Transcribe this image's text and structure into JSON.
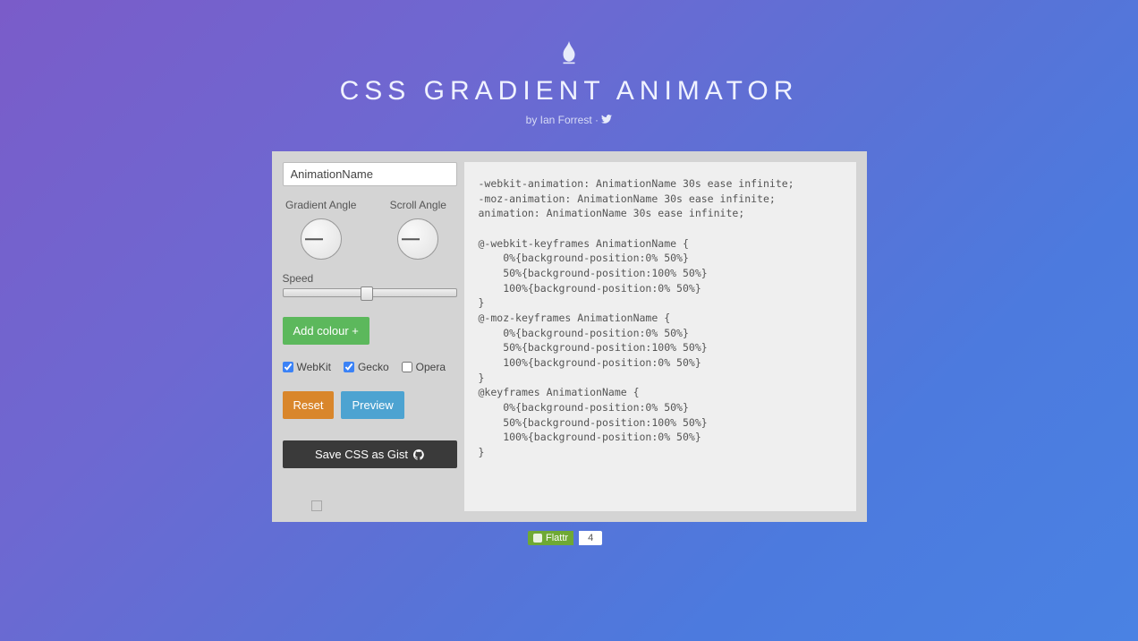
{
  "header": {
    "title": "CSS GRADIENT ANIMATOR",
    "byline_prefix": "by ",
    "author": "Ian Forrest",
    "separator": " · "
  },
  "controls": {
    "animation_name": "AnimationName",
    "gradient_angle_label": "Gradient Angle",
    "scroll_angle_label": "Scroll Angle",
    "speed_label": "Speed",
    "add_colour_label": "Add colour +",
    "vendors": {
      "webkit": {
        "label": "WebKit",
        "checked": true
      },
      "gecko": {
        "label": "Gecko",
        "checked": true
      },
      "opera": {
        "label": "Opera",
        "checked": false
      }
    },
    "reset_label": "Reset",
    "preview_label": "Preview",
    "gist_label": "Save CSS as Gist"
  },
  "code": "-webkit-animation: AnimationName 30s ease infinite;\n-moz-animation: AnimationName 30s ease infinite;\nanimation: AnimationName 30s ease infinite;\n\n@-webkit-keyframes AnimationName {\n    0%{background-position:0% 50%}\n    50%{background-position:100% 50%}\n    100%{background-position:0% 50%}\n}\n@-moz-keyframes AnimationName {\n    0%{background-position:0% 50%}\n    50%{background-position:100% 50%}\n    100%{background-position:0% 50%}\n}\n@keyframes AnimationName {\n    0%{background-position:0% 50%}\n    50%{background-position:100% 50%}\n    100%{background-position:0% 50%}\n}",
  "flattr": {
    "label": "Flattr",
    "count": "4"
  }
}
